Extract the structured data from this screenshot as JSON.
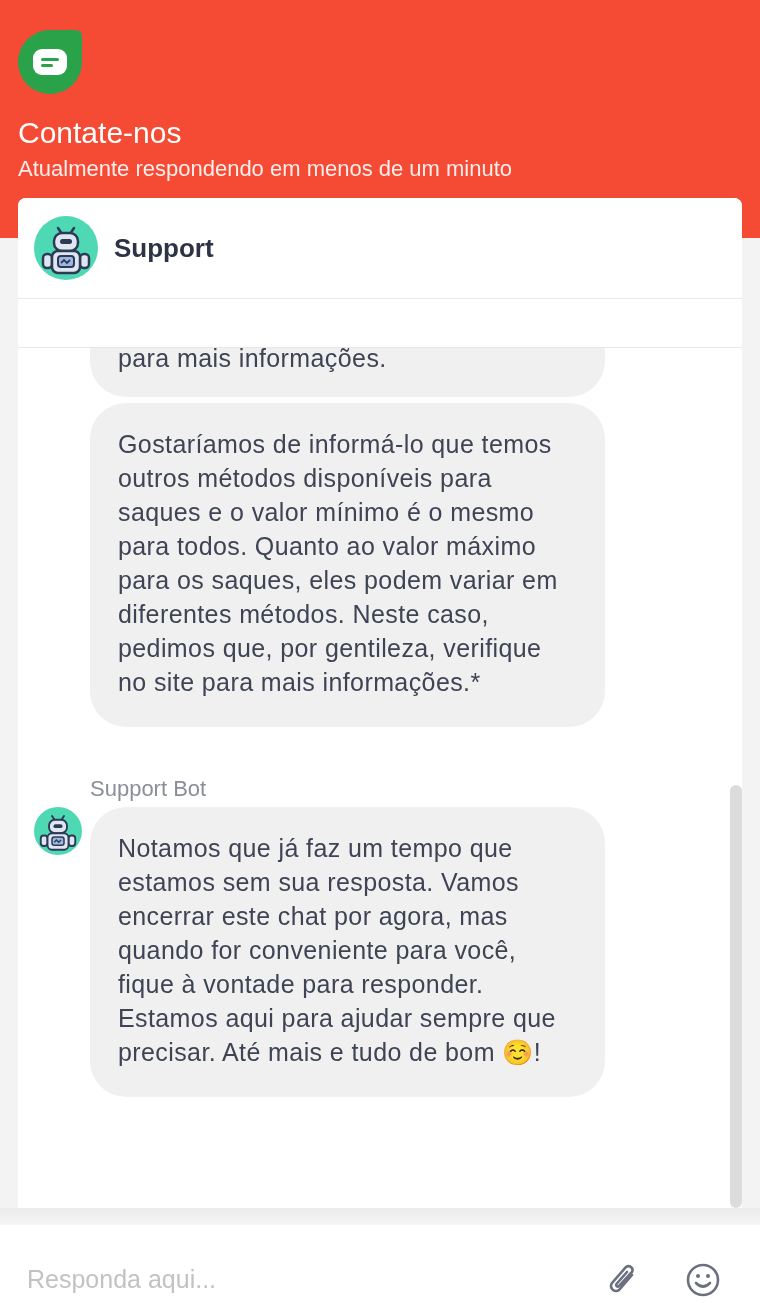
{
  "header": {
    "title": "Contate-nos",
    "subtitle": "Atualmente respondendo em menos de um minuto"
  },
  "chat": {
    "agent_name": "Support",
    "messages": [
      {
        "kind": "partial",
        "lines": [
          "para mais informações."
        ]
      },
      {
        "kind": "bubble",
        "text": "Gostaríamos de informá-lo que temos outros métodos disponíveis para saques e o valor mínimo é o mesmo para todos. Quanto ao valor máximo para os saques, eles podem variar em diferentes métodos. Neste caso, pedimos que, por gentileza, verifique no site para mais informações.*"
      },
      {
        "kind": "bubble",
        "sender": "Support Bot",
        "text": "Notamos que já faz um tempo que estamos sem sua resposta. Vamos encerrar este chat por agora, mas quando for conveniente para você, fique à vontade para responder. Estamos aqui para ajudar sempre que precisar. Até mais e tudo de bom ☺️!"
      }
    ]
  },
  "composer": {
    "placeholder": "Responda aqui..."
  }
}
